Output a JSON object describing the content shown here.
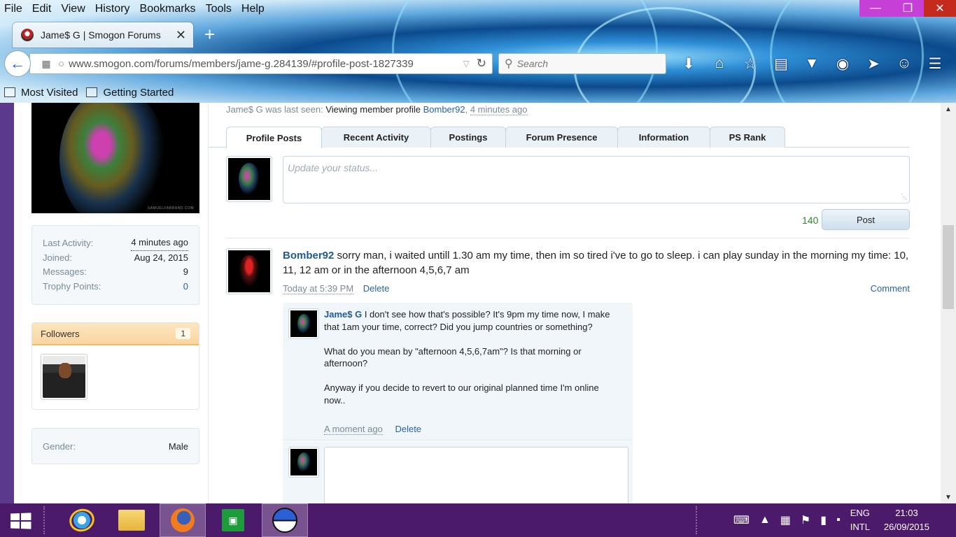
{
  "browser": {
    "menu": [
      "File",
      "Edit",
      "View",
      "History",
      "Bookmarks",
      "Tools",
      "Help"
    ],
    "tab_title": "Jame$ G | Smogon Forums",
    "url": "www.smogon.com/forums/members/jame-g.284139/#profile-post-1827339",
    "search_placeholder": "Search",
    "bookmarks": [
      "Most Visited",
      "Getting Started"
    ]
  },
  "profile": {
    "last_seen_prefix": "Jame$ G was last seen:",
    "last_seen_activity": "Viewing member profile",
    "last_seen_target": "Bomber92",
    "last_seen_time": "4 minutes ago",
    "tabs": [
      "Profile Posts",
      "Recent Activity",
      "Postings",
      "Forum Presence",
      "Information",
      "PS Rank"
    ],
    "status_placeholder": "Update your status...",
    "char_count": "140",
    "post_button": "Post"
  },
  "sidebar": {
    "stats": [
      {
        "label": "Last Activity:",
        "value": "4 minutes ago"
      },
      {
        "label": "Joined:",
        "value": "Aug 24, 2015"
      },
      {
        "label": "Messages:",
        "value": "9"
      },
      {
        "label": "Trophy Points:",
        "value": "0"
      }
    ],
    "followers_label": "Followers",
    "followers_count": "1",
    "gender_label": "Gender:",
    "gender_value": "Male"
  },
  "post": {
    "author": "Bomber92",
    "message": "sorry man, i waited untill 1.30 am my time, then im so tired i've to go to sleep. i can play sunday in the morning my time: 10, 11, 12 am or in the afternoon 4,5,6,7 am",
    "time": "Today at 5:39 PM",
    "delete_label": "Delete",
    "comment_label": "Comment"
  },
  "reply": {
    "author": "Jame$ G",
    "message": "I don't see how that's possible? It's 9pm my time now, I make that 1am your time, correct? Did you jump countries or something?\n\nWhat do you mean by \"afternoon 4,5,6,7am\"? Is that morning or afternoon?\n\nAnyway if you decide to revert to our original planned time I'm online now..",
    "time": "A moment ago",
    "delete_label": "Delete"
  },
  "taskbar": {
    "lang_top": "ENG",
    "lang_bottom": "INTL",
    "time": "21:03",
    "date": "26/09/2015"
  }
}
